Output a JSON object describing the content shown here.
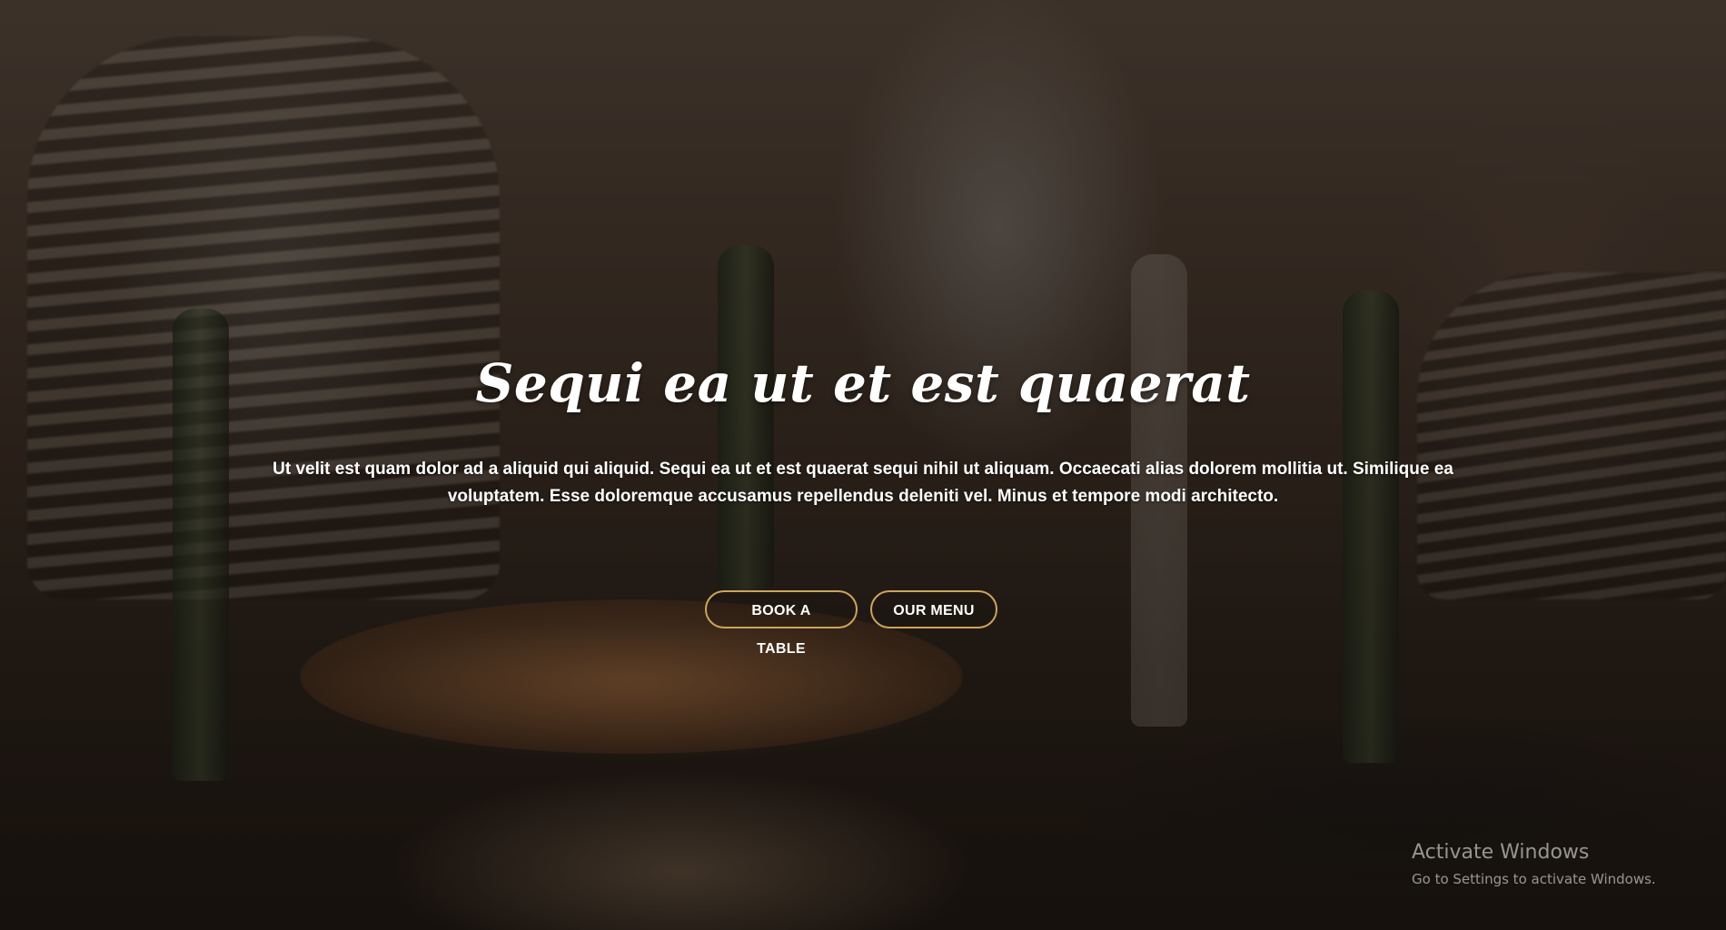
{
  "hero": {
    "title": "Sequi ea ut et est quaerat",
    "description": "Ut velit est quam dolor ad a aliquid qui aliquid. Sequi ea ut et est quaerat sequi nihil ut aliquam. Occaecati alias dolorem mollitia ut. Similique ea voluptatem. Esse doloremque accusamus repellendus deleniti vel. Minus et tempore modi architecto.",
    "buttons": {
      "book_label": "BOOK A TABLE",
      "menu_label": "OUR MENU"
    },
    "accent_color": "#cda45e"
  },
  "system_watermark": {
    "title": "Activate Windows",
    "subtitle": "Go to Settings to activate Windows."
  }
}
